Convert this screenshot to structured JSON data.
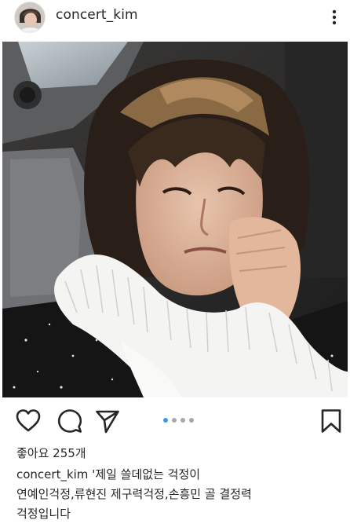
{
  "post": {
    "username": "concert_kim",
    "likes_text": "좋아요 255개",
    "caption_user": "concert_kim",
    "caption_line1": " '제일 쓸데없는 걱정이",
    "caption_line2": "연예인걱정,류현진 제구력걱정,손흥민 골 결정력",
    "caption_line3": "걱정입니다"
  },
  "carousel": {
    "total": 4,
    "active_index": 0,
    "active_color": "#3897f0",
    "inactive_color": "#a8a8a8"
  },
  "icons": {
    "more": "more-vertical-icon",
    "like": "heart-icon",
    "comment": "comment-icon",
    "share": "send-icon",
    "save": "bookmark-icon"
  }
}
